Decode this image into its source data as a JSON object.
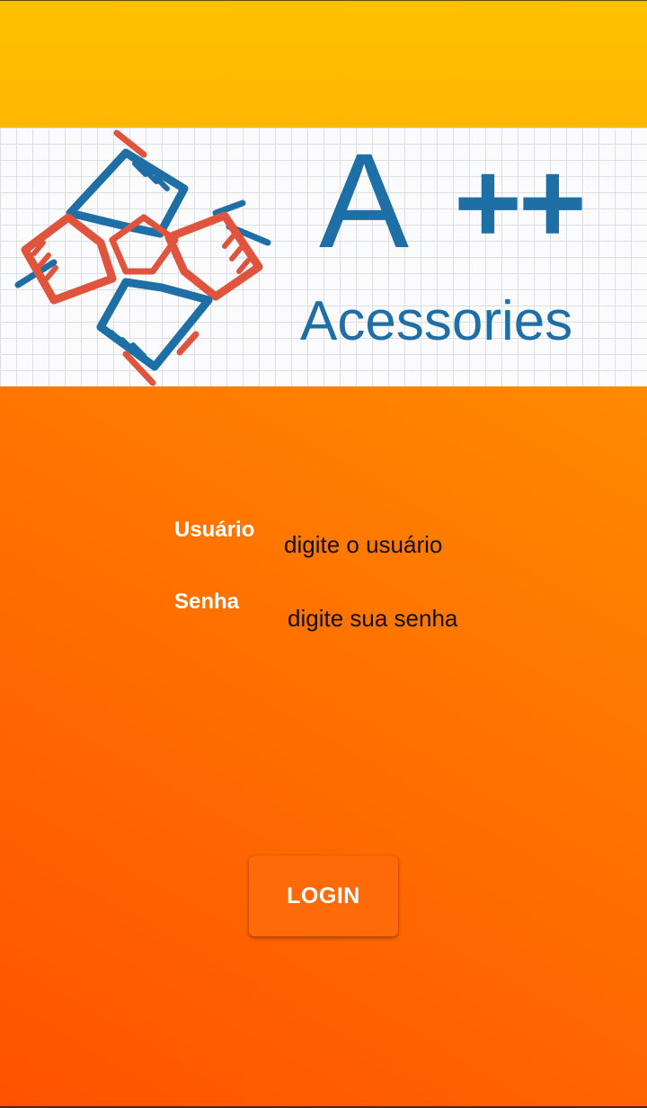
{
  "banner": {
    "logo_icon": "four-hands-teamwork-icon",
    "title_a": "A",
    "title_plus": "++",
    "subtitle": "Acessories",
    "brand_blue": "#1d6fa6",
    "brand_red": "#e0533d"
  },
  "form": {
    "user_label": "Usuário",
    "user_placeholder": "digite o usuário",
    "password_label": "Senha",
    "password_placeholder": "digite sua senha"
  },
  "actions": {
    "login_label": "LOGIN"
  },
  "colors": {
    "top_bar": "#ffc000",
    "background_start": "#ff5200",
    "background_end": "#ffb300",
    "button": "#ff6a08"
  }
}
